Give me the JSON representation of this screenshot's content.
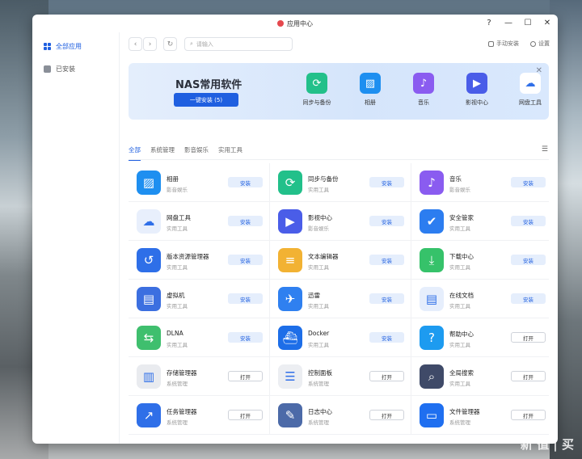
{
  "window": {
    "title": "应用中心",
    "controls": [
      "?",
      "—",
      "☐",
      "✕"
    ]
  },
  "sidebar": {
    "items": [
      {
        "label": "全部应用",
        "icon": "grid-icon",
        "active": true
      },
      {
        "label": "已安装",
        "icon": "download-icon",
        "active": false
      }
    ]
  },
  "toolbar": {
    "back": "‹",
    "forward": "›",
    "refresh": "↻",
    "search_placeholder": "请输入",
    "manual_install": "手动安装",
    "settings": "设置"
  },
  "banner": {
    "title": "NAS常用软件",
    "button": "一键安装 (5)",
    "close": "✕",
    "apps": [
      {
        "label": "同步与备份",
        "icon": "sync-icon",
        "color": "#22c08a"
      },
      {
        "label": "相册",
        "icon": "photo-icon",
        "color": "#1e8ff0"
      },
      {
        "label": "音乐",
        "icon": "music-icon",
        "color": "#8a5cf0"
      },
      {
        "label": "影视中心",
        "icon": "video-icon",
        "color": "#4a5de8"
      },
      {
        "label": "网盘工具",
        "icon": "cloud-drive-icon",
        "color": "#ffffff"
      }
    ]
  },
  "tabs": [
    "全部",
    "系统管理",
    "影音娱乐",
    "实用工具"
  ],
  "filter_icon": "☰",
  "apps": [
    {
      "name": "相册",
      "category": "影音娱乐",
      "action": "安装",
      "type": "install",
      "icon": "photo-icon",
      "color": "#1e8ff0"
    },
    {
      "name": "同步与备份",
      "category": "实用工具",
      "action": "安装",
      "type": "install",
      "icon": "sync-icon",
      "color": "#22c08a"
    },
    {
      "name": "音乐",
      "category": "影音娱乐",
      "action": "安装",
      "type": "install",
      "icon": "music-icon",
      "color": "#8a5cf0"
    },
    {
      "name": "网盘工具",
      "category": "实用工具",
      "action": "安装",
      "type": "install",
      "icon": "cloud-drive-icon",
      "color": "#e8effc"
    },
    {
      "name": "影视中心",
      "category": "影音娱乐",
      "action": "安装",
      "type": "install",
      "icon": "video-icon",
      "color": "#4a5de8"
    },
    {
      "name": "安全管家",
      "category": "实用工具",
      "action": "安装",
      "type": "install",
      "icon": "shield-icon",
      "color": "#2c7df0"
    },
    {
      "name": "版本资源管理器",
      "category": "实用工具",
      "action": "安装",
      "type": "install",
      "icon": "version-icon",
      "color": "#2e6fe8"
    },
    {
      "name": "文本编辑器",
      "category": "实用工具",
      "action": "安装",
      "type": "install",
      "icon": "text-editor-icon",
      "color": "#f2b233"
    },
    {
      "name": "下载中心",
      "category": "实用工具",
      "action": "安装",
      "type": "install",
      "icon": "download-icon",
      "color": "#36c26a"
    },
    {
      "name": "虚拟机",
      "category": "实用工具",
      "action": "安装",
      "type": "install",
      "icon": "vm-icon",
      "color": "#3c6fe0"
    },
    {
      "name": "迅雷",
      "category": "实用工具",
      "action": "安装",
      "type": "install",
      "icon": "thunder-icon",
      "color": "#2f80f0"
    },
    {
      "name": "在线文档",
      "category": "实用工具",
      "action": "安装",
      "type": "install",
      "icon": "doc-icon",
      "color": "#e6eefc"
    },
    {
      "name": "DLNA",
      "category": "实用工具",
      "action": "安装",
      "type": "install",
      "icon": "dlna-icon",
      "color": "#3fbf6e"
    },
    {
      "name": "Docker",
      "category": "实用工具",
      "action": "安装",
      "type": "install",
      "icon": "docker-icon",
      "color": "#1d6ee8"
    },
    {
      "name": "帮助中心",
      "category": "实用工具",
      "action": "打开",
      "type": "open",
      "icon": "help-icon",
      "color": "#1d9bf0"
    },
    {
      "name": "存储管理器",
      "category": "系统管理",
      "action": "打开",
      "type": "open",
      "icon": "storage-icon",
      "color": "#e9ebef"
    },
    {
      "name": "控制面板",
      "category": "系统管理",
      "action": "打开",
      "type": "open",
      "icon": "control-panel-icon",
      "color": "#eceef2"
    },
    {
      "name": "全局搜索",
      "category": "实用工具",
      "action": "打开",
      "type": "open",
      "icon": "search-icon",
      "color": "#3f4a68"
    },
    {
      "name": "任务管理器",
      "category": "系统管理",
      "action": "打开",
      "type": "open",
      "icon": "task-manager-icon",
      "color": "#2f6fe8"
    },
    {
      "name": "日志中心",
      "category": "系统管理",
      "action": "打开",
      "type": "open",
      "icon": "log-icon",
      "color": "#4c6aa8"
    },
    {
      "name": "文件管理器",
      "category": "系统管理",
      "action": "打开",
      "type": "open",
      "icon": "folder-icon",
      "color": "#1f6ff0"
    }
  ],
  "watermark": {
    "main": "新 值 | 买",
    "sub": "浪"
  }
}
